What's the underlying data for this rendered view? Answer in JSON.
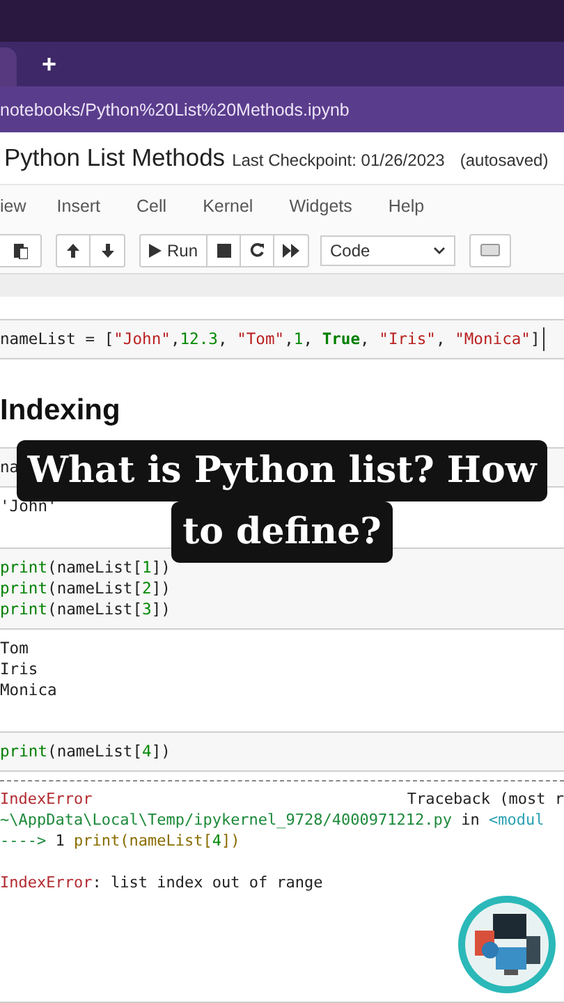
{
  "browser": {
    "new_tab": "+",
    "url": "notebooks/Python%20List%20Methods.ipynb"
  },
  "notebook": {
    "title": "Python List Methods",
    "checkpoint": "Last Checkpoint: 01/26/2023",
    "autosave": "(autosaved)"
  },
  "menu": [
    "iew",
    "Insert",
    "Cell",
    "Kernel",
    "Widgets",
    "Help"
  ],
  "toolbar": {
    "run_label": "Run",
    "cell_type": "Code"
  },
  "cells": [
    {
      "kind": "code",
      "cursor": true,
      "lines": [
        [
          {
            "text": "nameList = ["
          },
          {
            "text": "\"John\"",
            "kind": "str"
          },
          {
            "text": ","
          },
          {
            "text": "12.3",
            "kind": "num"
          },
          {
            "text": ", "
          },
          {
            "text": "\"Tom\"",
            "kind": "str"
          },
          {
            "text": ","
          },
          {
            "text": "1",
            "kind": "num"
          },
          {
            "text": ", "
          },
          {
            "text": "True",
            "kind": "kw"
          },
          {
            "text": ", "
          },
          {
            "text": "\"Iris\"",
            "kind": "str"
          },
          {
            "text": ", "
          },
          {
            "text": "\"Monica\"",
            "kind": "str"
          },
          {
            "text": "]"
          }
        ]
      ]
    },
    {
      "kind": "heading",
      "text": "Indexing"
    },
    {
      "kind": "code",
      "cursor": false,
      "lines": [
        [
          {
            "text": "na"
          }
        ]
      ]
    },
    {
      "kind": "output",
      "lines": [
        "'John'"
      ]
    },
    {
      "kind": "code",
      "cursor": false,
      "lines": [
        [
          {
            "text": "print",
            "kind": "builtin"
          },
          {
            "text": "(nameList["
          },
          {
            "text": "1",
            "kind": "num"
          },
          {
            "text": "])"
          }
        ],
        [
          {
            "text": "print",
            "kind": "builtin"
          },
          {
            "text": "(nameList["
          },
          {
            "text": "2",
            "kind": "num"
          },
          {
            "text": "])"
          }
        ],
        [
          {
            "text": "print",
            "kind": "builtin"
          },
          {
            "text": "(nameList["
          },
          {
            "text": "3",
            "kind": "num"
          },
          {
            "text": "])"
          }
        ]
      ]
    },
    {
      "kind": "output",
      "lines": [
        "Tom",
        "Iris",
        "Monica"
      ]
    },
    {
      "kind": "code",
      "cursor": false,
      "lines": [
        [
          {
            "text": "print",
            "kind": "builtin"
          },
          {
            "text": "(nameList["
          },
          {
            "text": "4",
            "kind": "num"
          },
          {
            "text": "])"
          }
        ]
      ]
    },
    {
      "kind": "error",
      "name": "IndexError",
      "traceback": "Traceback (most r",
      "lines": [
        [
          {
            "text": "~\\AppData\\Local\\Temp/ipykernel_9728/4000971212.py",
            "kind": "path"
          },
          {
            "text": " in "
          },
          {
            "text": "<modul",
            "kind": "module"
          }
        ],
        [
          {
            "text": "---->",
            "kind": "path"
          },
          {
            "text": " 1 "
          },
          {
            "text": "print(nameList[",
            "kind": "tb"
          },
          {
            "text": "4",
            "kind": "num"
          },
          {
            "text": "])",
            "kind": "tb"
          }
        ]
      ],
      "message": [
        {
          "text": "IndexError",
          "kind": "error"
        },
        {
          "text": ": list index out of range"
        }
      ]
    }
  ],
  "caption": [
    "What is Python list? How",
    "to define?"
  ]
}
